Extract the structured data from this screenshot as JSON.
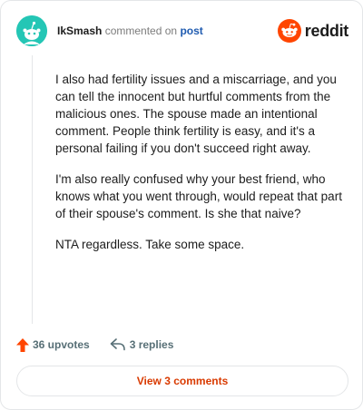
{
  "header": {
    "author": "IkSmash",
    "action": "commented on",
    "post_link": "post",
    "brand": "reddit"
  },
  "comment": {
    "paragraphs": [
      "I also had fertility issues and a miscarriage, and you can tell the innocent but hurtful comments from the malicious ones. The spouse made an intentional comment. People think fertility is easy, and it's a personal failing if you don't succeed right away.",
      "I'm also really confused why your best friend, who knows what you went through, would repeat that part of their spouse's comment. Is she that naive?",
      "NTA regardless. Take some space."
    ]
  },
  "footer": {
    "upvotes": "36 upvotes",
    "replies": "3 replies"
  },
  "view_button": "View 3 comments",
  "icons": {
    "avatar": "snoo-avatar-icon",
    "brand": "reddit-logo-icon",
    "upvote": "upvote-arrow-icon",
    "reply": "reply-arrow-icon"
  },
  "colors": {
    "accent": "#d93a00",
    "upvote": "#ff4500",
    "avatar_bg": "#24c6b5",
    "link": "#1f5bb0"
  }
}
